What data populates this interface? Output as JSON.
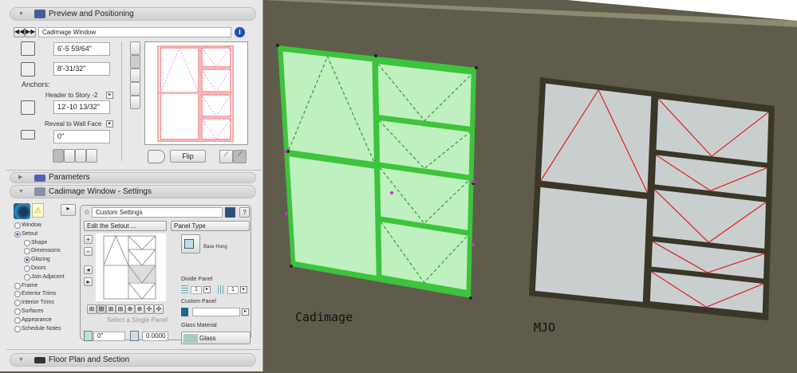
{
  "panel": {
    "preview": {
      "title": "Preview and Positioning",
      "object_name": "Cadimage Window",
      "width": "6'-5 59/64\"",
      "height": "8'-31/32\"",
      "anchors_label": "Anchors:",
      "anchor_option": "Header to Story -2",
      "anchor_value": "12'-10 13/32\"",
      "reveal_option": "Reveal to Wall Face",
      "reveal_value": "0\"",
      "flip_label": "Flip"
    },
    "parameters": {
      "title": "Parameters"
    },
    "settings": {
      "title": "Cadimage Window - Settings",
      "tree": [
        {
          "label": "Window",
          "checked": false,
          "indent": 0
        },
        {
          "label": "Setout",
          "checked": true,
          "indent": 0
        },
        {
          "label": "Shape",
          "checked": false,
          "indent": 1
        },
        {
          "label": "Dimensions",
          "checked": false,
          "indent": 1
        },
        {
          "label": "Glazing",
          "checked": true,
          "indent": 1
        },
        {
          "label": "Doors",
          "checked": false,
          "indent": 1
        },
        {
          "label": "Join Adjacent",
          "checked": false,
          "indent": 1
        },
        {
          "label": "Frame",
          "checked": false,
          "indent": 0
        },
        {
          "label": "Exterior Trims",
          "checked": false,
          "indent": 0
        },
        {
          "label": "Interior Trims",
          "checked": false,
          "indent": 0
        },
        {
          "label": "Surfaces",
          "checked": false,
          "indent": 0
        },
        {
          "label": "Appearance",
          "checked": false,
          "indent": 0
        },
        {
          "label": "Schedule Notes",
          "checked": false,
          "indent": 0
        }
      ],
      "custom_settings": "Custom Settings",
      "help": "?",
      "edit_setout": "Edit the Setout ...",
      "panel_type": "Panel Type",
      "panel_type_value": "Base Hung",
      "select_hint": "Select a Single Panel",
      "divide_panel_label": "Divide Panel",
      "divide_rows": "1",
      "divide_cols": "1",
      "custom_panel_label": "Custom Panel",
      "custom_panel_value": "",
      "glass_material_label": "Glass Material",
      "glass_material": "Glass",
      "offset_value": "0\"",
      "angle_value": "0.0000"
    },
    "floorplan": {
      "title": "Floor Plan and Section"
    }
  },
  "viewport": {
    "label_left": "Cadimage",
    "label_right": "MJO",
    "colors": {
      "wall": "#5f5c4c",
      "selected": "#3cc43c",
      "glass_selected": "#bff0bf",
      "frame": "#3a3628",
      "glass": "#c9cfcf",
      "opening_line": "#e02020"
    }
  }
}
